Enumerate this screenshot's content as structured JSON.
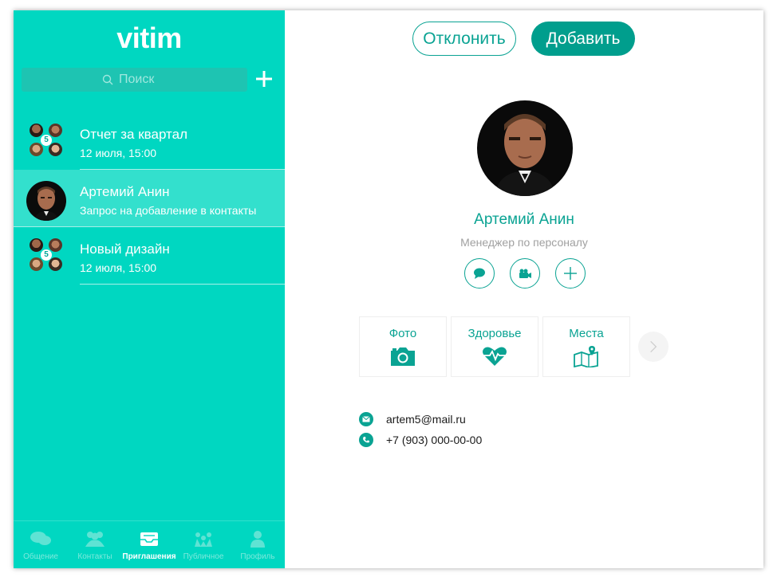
{
  "app": {
    "logo": "vitim"
  },
  "search": {
    "placeholder": "Поиск"
  },
  "chats": [
    {
      "title": "Отчет за квартал",
      "subtitle": "12 июля, 15:00",
      "type": "group",
      "badge": "5"
    },
    {
      "title": "Артемий Анин",
      "subtitle": "Запрос на добавление в контакты",
      "type": "single",
      "active": true
    },
    {
      "title": "Новый дизайн",
      "subtitle": "12 июля, 15:00",
      "type": "group",
      "badge": "5"
    }
  ],
  "tabs": [
    {
      "label": "Общение",
      "icon": "chat-bubbles-icon"
    },
    {
      "label": "Контакты",
      "icon": "people-icon"
    },
    {
      "label": "Приглашения",
      "icon": "inbox-icon",
      "active": true
    },
    {
      "label": "Публичное",
      "icon": "public-icon"
    },
    {
      "label": "Профиль",
      "icon": "person-icon"
    }
  ],
  "actions": {
    "decline": "Отклонить",
    "accept": "Добавить"
  },
  "profile": {
    "name": "Артемий Анин",
    "role": "Менеджер по персоналу",
    "email": "artem5@mail.ru",
    "phone": "+7 (903) 000-00-00"
  },
  "tiles": [
    {
      "label": "Фото",
      "icon": "camera-icon"
    },
    {
      "label": "Здоровье",
      "icon": "heart-pulse-icon"
    },
    {
      "label": "Места",
      "icon": "map-pin-icon"
    }
  ],
  "colors": {
    "sidebar": "#00d7c1",
    "accent": "#0aa393",
    "active_row": "#33e0cd"
  }
}
